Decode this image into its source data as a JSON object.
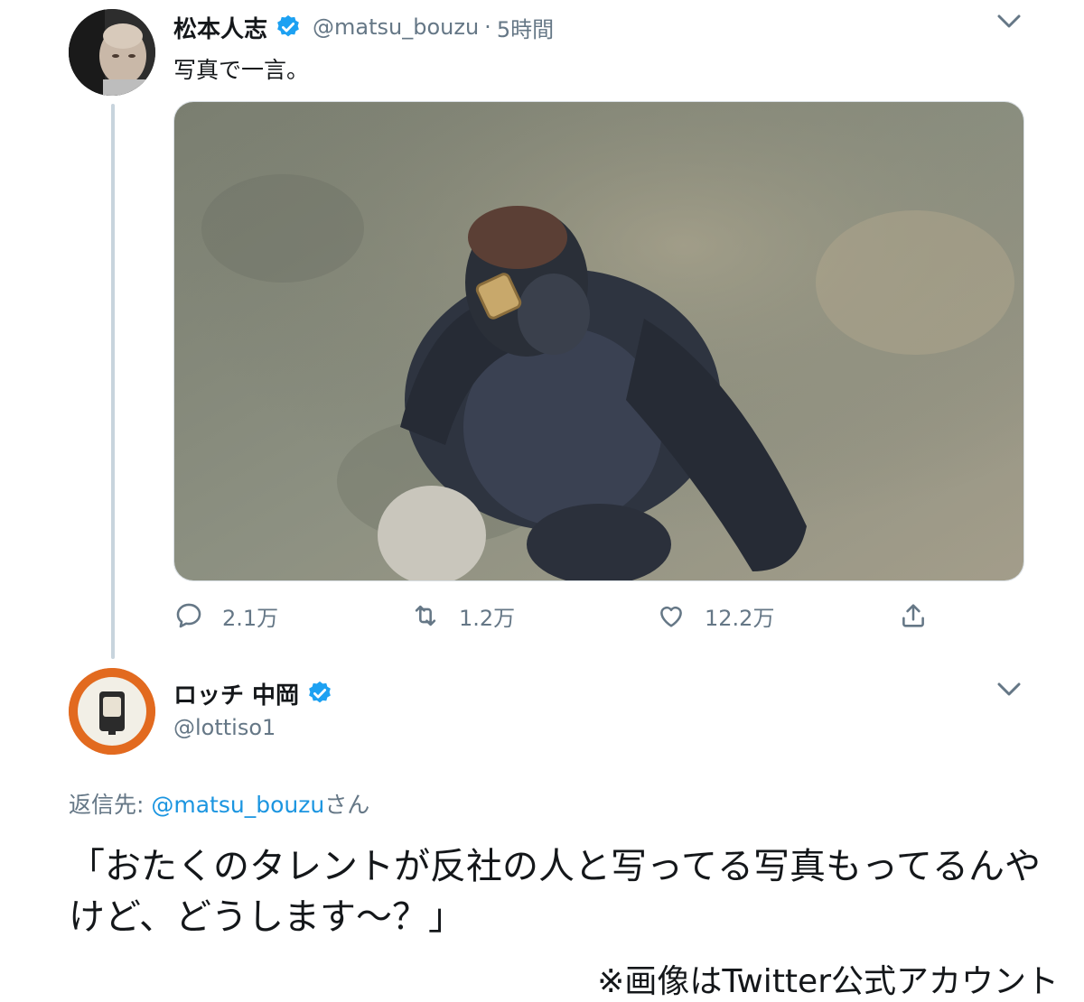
{
  "tweet": {
    "display_name": "松本人志",
    "handle": "@matsu_bouzu",
    "separator": "·",
    "time": "5時間",
    "text": "写真で一言。",
    "stats": {
      "replies": "2.1万",
      "retweets": "1.2万",
      "likes": "12.2万"
    }
  },
  "reply": {
    "display_name": "ロッチ 中岡",
    "handle": "@lottiso1",
    "reply_prefix": "返信先: ",
    "reply_mention": "@matsu_bouzu",
    "reply_suffix": "さん",
    "text": "「おたくのタレントが反社の人と写ってる写真もってるんやけど、どうします～？」"
  },
  "credit": "※画像はTwitter公式アカウント",
  "colors": {
    "verified": "#1da1f2",
    "secondary_text": "#657786",
    "mention": "#1b95e0",
    "thread_line": "#c8d4dd"
  },
  "icons": [
    "verified-badge-icon",
    "chevron-down-icon",
    "reply-icon",
    "retweet-icon",
    "like-icon",
    "share-icon"
  ]
}
